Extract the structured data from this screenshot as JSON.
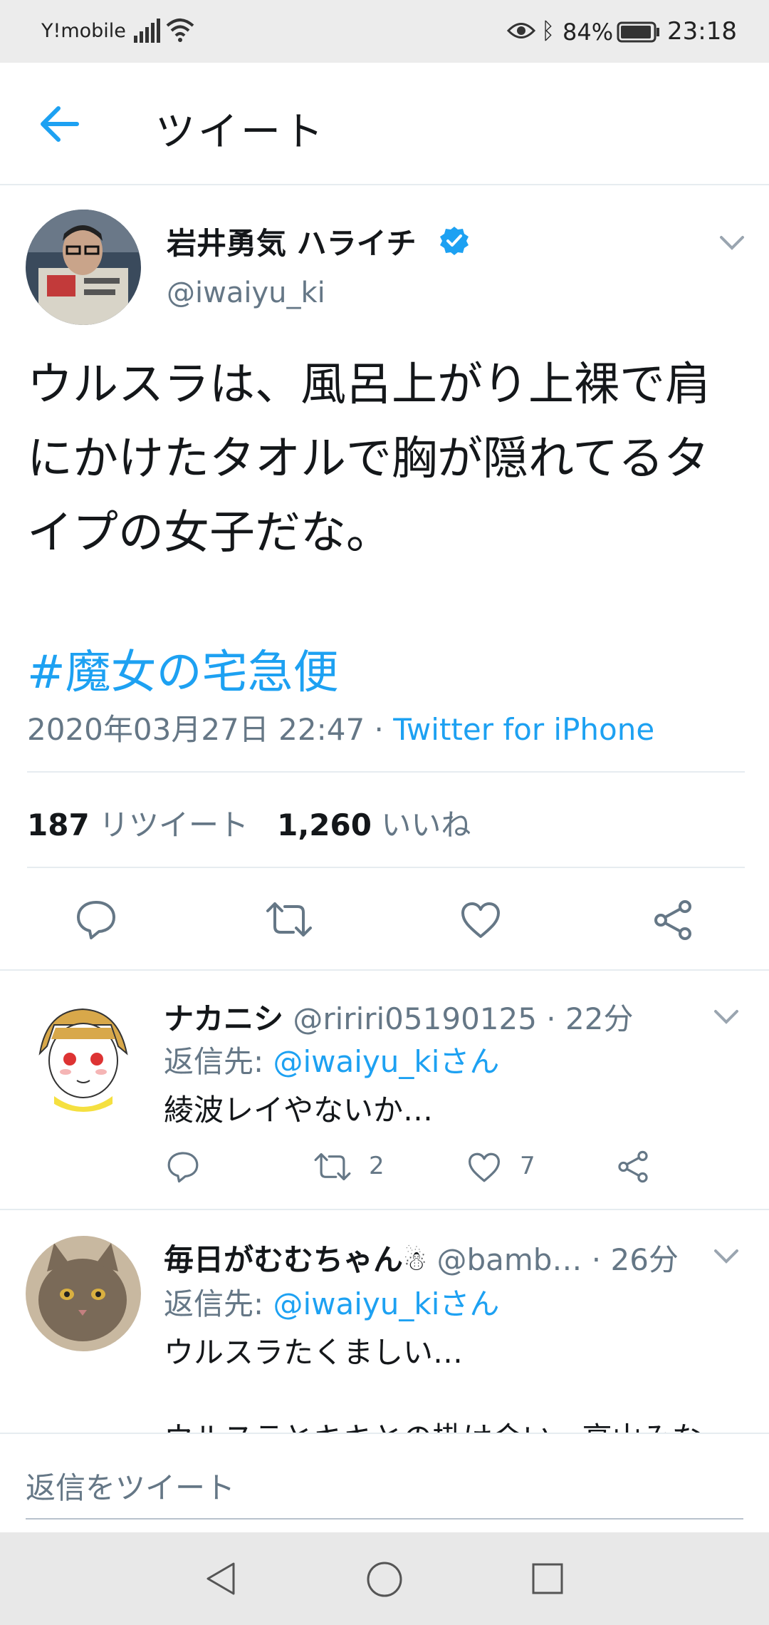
{
  "status_bar": {
    "carrier": "Y!mobile",
    "battery": "84%",
    "time": "23:18"
  },
  "header": {
    "title": "ツイート"
  },
  "tweet": {
    "author_name": "岩井勇気 ハライチ",
    "handle": "@iwaiyu_ki",
    "text_lines": [
      "ウルスラは、風呂上がり上裸で肩",
      "にかけたタオルで胸が隠れてるタ",
      "イプの女子だな。"
    ],
    "hashtag": "#魔女の宅急便",
    "timestamp": "2020年03月27日 22:47 · ",
    "source": "Twitter for iPhone",
    "retweet_count": "187",
    "retweet_label": "リツイート",
    "like_count": "1,260",
    "like_label": "いいね"
  },
  "replies": [
    {
      "name": "ナカニシ",
      "handle_time": "@ririri05190125 · 22分",
      "reply_to_prefix": "返信先: ",
      "reply_to_user": "@iwaiyu_kiさん",
      "text": "綾波レイやないか…",
      "retweets": "2",
      "likes": "7"
    },
    {
      "name": "毎日がむむちゃん",
      "handle_time": "@bamb… · 26分",
      "reply_to_prefix": "返信先: ",
      "reply_to_user": "@iwaiyu_kiさん",
      "text": "ウルスラたくましい…",
      "text2": "ウルスラとキキとの掛け合い、高山みな"
    }
  ],
  "compose": {
    "placeholder": "返信をツイート"
  },
  "colors": {
    "accent": "#1da1f2",
    "secondary_text": "#657786",
    "divider": "#e6ecf0"
  }
}
